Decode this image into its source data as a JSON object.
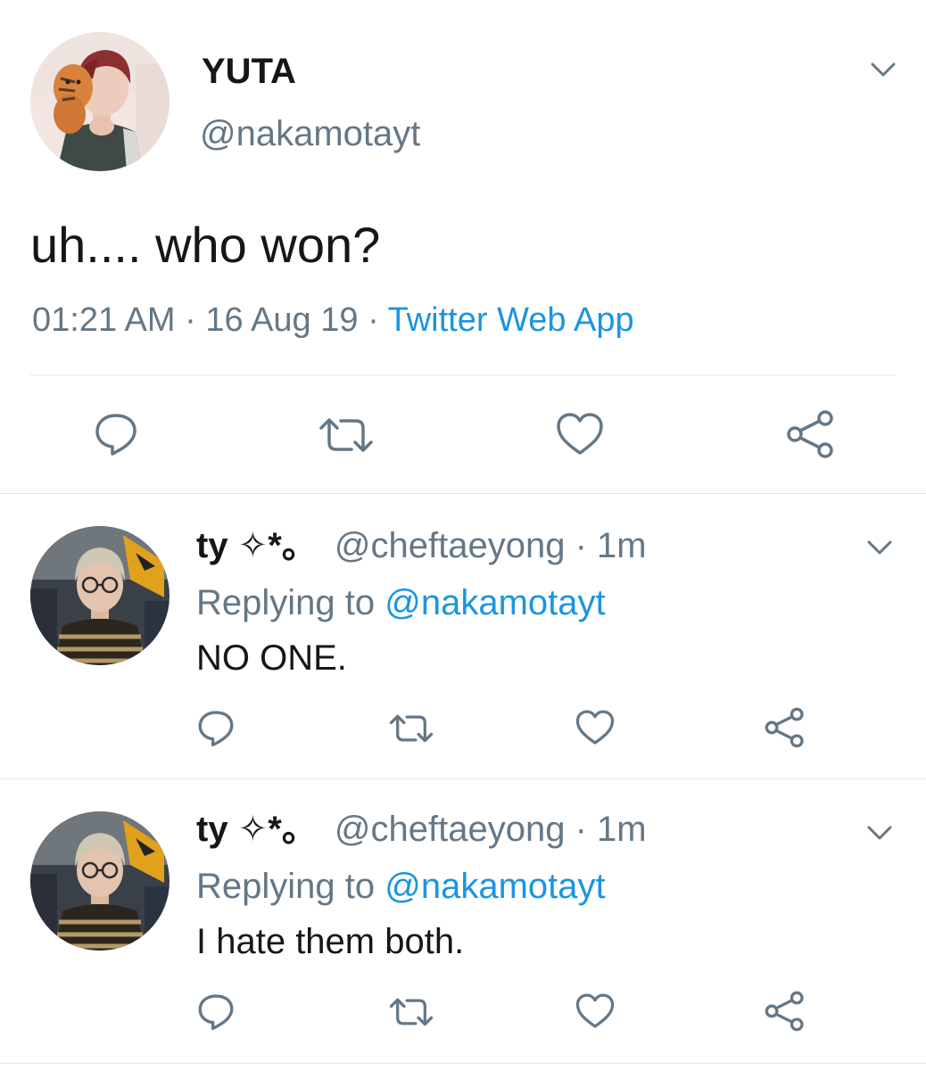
{
  "colors": {
    "text": "#14171a",
    "muted": "#657786",
    "link": "#1b95e0",
    "divider": "#e1e8ed",
    "background": "#ffffff"
  },
  "main_tweet": {
    "display_name": "YUTA",
    "handle": "@nakamotayt",
    "text": "uh.... who won?",
    "time": "01:21 AM",
    "separator": "·",
    "date": "16 Aug 19",
    "source": "Twitter Web App",
    "icons": [
      "chevron-down-icon",
      "reply-icon",
      "retweet-icon",
      "like-icon",
      "share-icon"
    ]
  },
  "replies": [
    {
      "display_name": "ty ✧*。",
      "handle": "@cheftaeyong",
      "separator": "·",
      "time": "1m",
      "replying_prefix": "Replying to",
      "replying_handle": "@nakamotayt",
      "text": "NO ONE."
    },
    {
      "display_name": "ty ✧*。",
      "handle": "@cheftaeyong",
      "separator": "·",
      "time": "1m",
      "replying_prefix": "Replying to",
      "replying_handle": "@nakamotayt",
      "text": "I hate them both."
    }
  ]
}
